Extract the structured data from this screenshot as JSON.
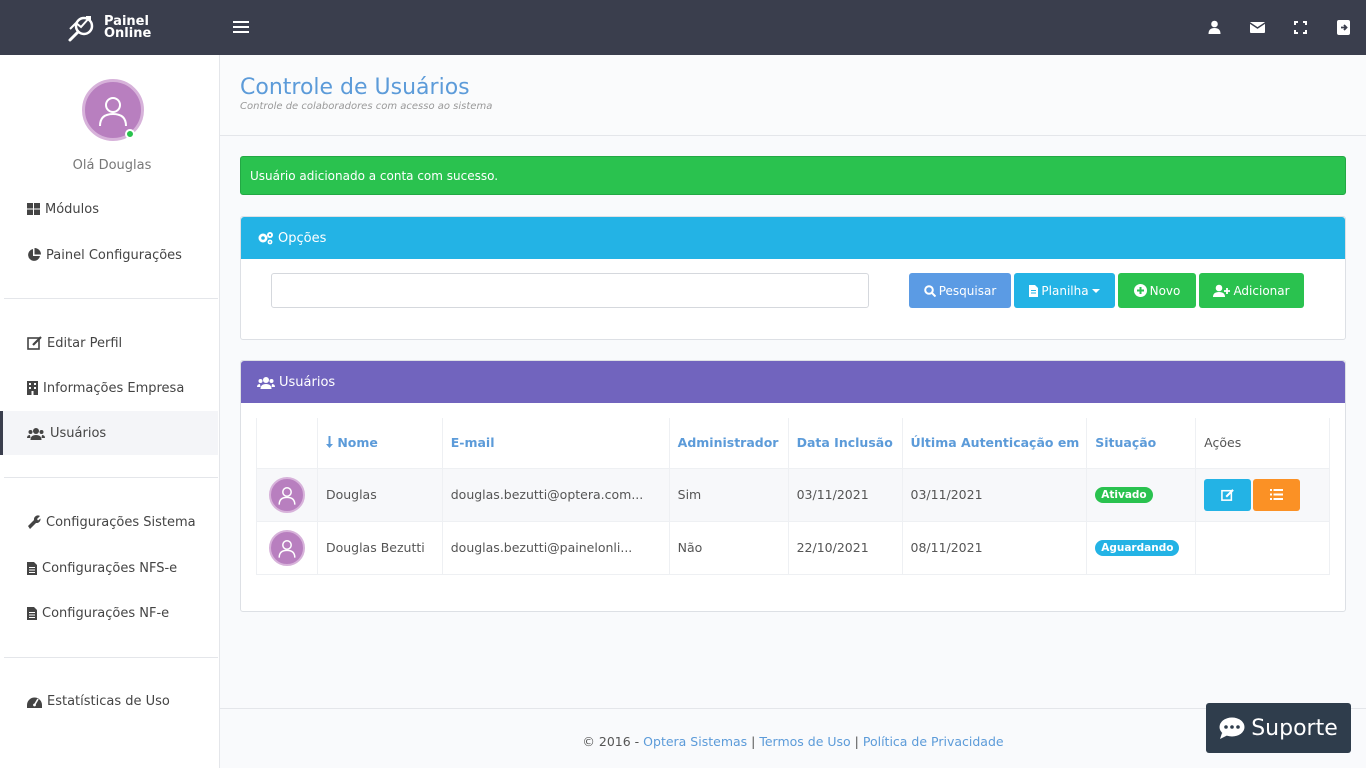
{
  "brand": {
    "line1": "Painel",
    "line2": "Online"
  },
  "user": {
    "greeting": "Olá Douglas"
  },
  "sidebar": {
    "items": [
      {
        "label": "Módulos",
        "icon": "grid-icon"
      },
      {
        "label": "Painel Configurações",
        "icon": "pie-chart-icon"
      },
      {
        "label": "Editar Perfil",
        "icon": "edit-icon"
      },
      {
        "label": "Informações Empresa",
        "icon": "building-icon"
      },
      {
        "label": "Usuários",
        "icon": "users-icon"
      },
      {
        "label": "Configurações Sistema",
        "icon": "wrench-icon"
      },
      {
        "label": "Configurações NFS-e",
        "icon": "file-icon"
      },
      {
        "label": "Configurações NF-e",
        "icon": "file-icon"
      },
      {
        "label": "Estatísticas de Uso",
        "icon": "dashboard-icon"
      }
    ]
  },
  "page": {
    "title": "Controle de Usuários",
    "subtitle": "Controle de colaboradores com acesso ao sistema"
  },
  "alert": {
    "message": "Usuário adicionado a conta com sucesso."
  },
  "opcoes": {
    "title": "Opções",
    "search_placeholder": "",
    "buttons": {
      "pesquisar": "Pesquisar",
      "planilha": "Planilha",
      "novo": "Novo",
      "adicionar": "Adicionar"
    }
  },
  "usuarios": {
    "title": "Usuários",
    "columns": [
      "",
      "Nome",
      "E-mail",
      "Administrador",
      "Data Inclusão",
      "Última Autenticação em",
      "Situação",
      "Ações"
    ],
    "rows": [
      {
        "nome": "Douglas",
        "email": "douglas.bezutti@optera.com...",
        "admin": "Sim",
        "inclusao": "03/11/2021",
        "autenticacao": "03/11/2021",
        "situacao": "Ativado"
      },
      {
        "nome": "Douglas Bezutti",
        "email": "douglas.bezutti@painelonli...",
        "admin": "Não",
        "inclusao": "22/10/2021",
        "autenticacao": "08/11/2021",
        "situacao": "Aguardando"
      }
    ]
  },
  "footer": {
    "copyright": "© 2016 - ",
    "company": "Optera Sistemas",
    "sep1": " | ",
    "terms": "Termos de Uso",
    "sep2": " | ",
    "privacy": "Política de Privacidade"
  },
  "support": {
    "label": "Suporte"
  },
  "colors": {
    "topbar": "#3a3e4d",
    "accent_blue": "#5c9bd9",
    "success": "#2ac24f",
    "info": "#23b3e5",
    "purple": "#7164be",
    "warning": "#fb9125"
  }
}
